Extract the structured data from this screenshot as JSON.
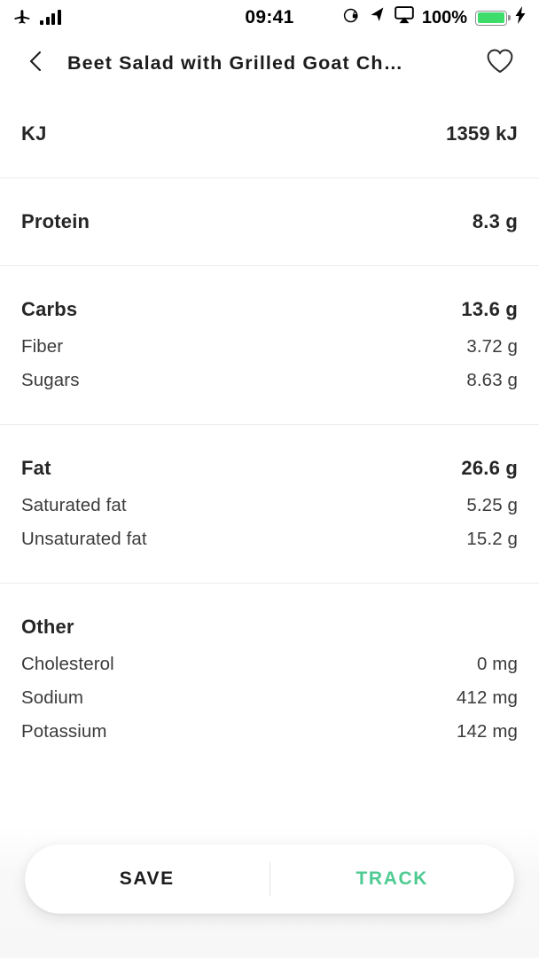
{
  "status_bar": {
    "airplane_icon": "airplane-icon",
    "signal_icon": "signal-bars-icon",
    "time": "09:41",
    "rotation_lock_icon": "rotation-lock-icon",
    "location_icon": "location-arrow-icon",
    "airplay_icon": "airplay-icon",
    "battery_percent": "100%",
    "battery_icon": "battery-icon",
    "charging_icon": "lightning-bolt-icon"
  },
  "nav": {
    "back_icon": "chevron-left-icon",
    "title": "Beet Salad with Grilled Goat Ch…",
    "favorite_icon": "heart-outline-icon"
  },
  "nutrition": {
    "sections": [
      {
        "name": "energy",
        "label": "KJ",
        "value": "1359 kJ",
        "items": []
      },
      {
        "name": "protein",
        "label": "Protein",
        "value": "8.3 g",
        "items": []
      },
      {
        "name": "carbs",
        "label": "Carbs",
        "value": "13.6 g",
        "items": [
          {
            "label": "Fiber",
            "value": "3.72 g"
          },
          {
            "label": "Sugars",
            "value": "8.63 g"
          }
        ]
      },
      {
        "name": "fat",
        "label": "Fat",
        "value": "26.6 g",
        "items": [
          {
            "label": "Saturated fat",
            "value": "5.25 g"
          },
          {
            "label": "Unsaturated fat",
            "value": "15.2 g"
          }
        ]
      },
      {
        "name": "other",
        "label": "Other",
        "value": "",
        "items": [
          {
            "label": "Cholesterol",
            "value": "0 mg"
          },
          {
            "label": "Sodium",
            "value": "412 mg"
          },
          {
            "label": "Potassium",
            "value": "142 mg"
          }
        ]
      }
    ]
  },
  "actions": {
    "save_label": "SAVE",
    "track_label": "TRACK",
    "track_color": "#4ecb92"
  }
}
